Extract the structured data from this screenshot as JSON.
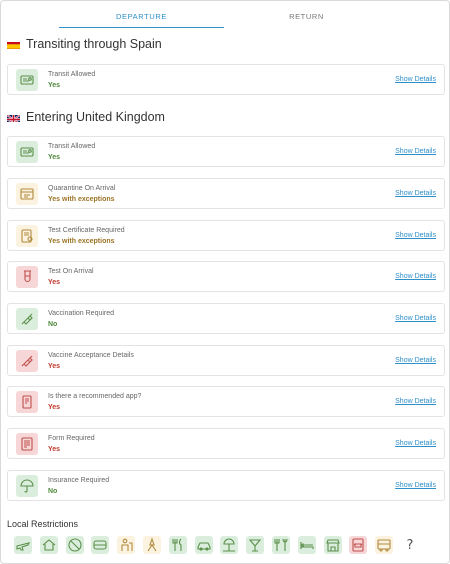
{
  "tabs": [
    {
      "label": "DEPARTURE",
      "active": true
    },
    {
      "label": "RETURN",
      "active": false
    }
  ],
  "transit": {
    "heading": "Transiting through Spain",
    "flag": "spain-flag",
    "items": [
      {
        "label": "Transit Allowed",
        "value": "Yes",
        "status": "green",
        "icon": "passport-icon",
        "details": "Show Details"
      }
    ]
  },
  "entry": {
    "heading": "Entering United Kingdom",
    "flag": "uk-flag",
    "items": [
      {
        "label": "Transit Allowed",
        "value": "Yes",
        "status": "green",
        "icon": "passport-icon",
        "details": "Show Details"
      },
      {
        "label": "Quarantine On Arrival",
        "value": "Yes with exceptions",
        "status": "yellow",
        "icon": "quarantine-icon",
        "details": "Show Details"
      },
      {
        "label": "Test Certificate Required",
        "value": "Yes with exceptions",
        "status": "yellow",
        "icon": "certificate-icon",
        "details": "Show Details"
      },
      {
        "label": "Test On Arrival",
        "value": "Yes",
        "status": "red",
        "icon": "test-tube-icon",
        "details": "Show Details"
      },
      {
        "label": "Vaccination Required",
        "value": "No",
        "status": "green",
        "icon": "syringe-icon",
        "details": "Show Details"
      },
      {
        "label": "Vaccine Acceptance Details",
        "value": "Yes",
        "status": "red",
        "icon": "syringe-icon",
        "details": "Show Details"
      },
      {
        "label": "Is there a recommended app?",
        "value": "Yes",
        "status": "red",
        "icon": "phone-app-icon",
        "details": "Show Details"
      },
      {
        "label": "Form Required",
        "value": "Yes",
        "status": "red",
        "icon": "form-icon",
        "details": "Show Details"
      },
      {
        "label": "Insurance Required",
        "value": "No",
        "status": "green",
        "icon": "umbrella-icon",
        "details": "Show Details"
      }
    ]
  },
  "local_restrictions": {
    "title": "Local Restrictions",
    "icons": [
      {
        "name": "domestic-flight-icon",
        "status": "green"
      },
      {
        "name": "home-icon",
        "status": "green"
      },
      {
        "name": "no-gathering-icon",
        "status": "green"
      },
      {
        "name": "public-transport-icon",
        "status": "green"
      },
      {
        "name": "workplace-icon",
        "status": "yellow"
      },
      {
        "name": "tourism-icon",
        "status": "yellow"
      },
      {
        "name": "restaurant-icon",
        "status": "green"
      },
      {
        "name": "car-icon",
        "status": "green"
      },
      {
        "name": "beach-icon",
        "status": "green"
      },
      {
        "name": "bar-icon",
        "status": "green"
      },
      {
        "name": "dining-icon",
        "status": "green"
      },
      {
        "name": "hotel-icon",
        "status": "green"
      },
      {
        "name": "shop-icon",
        "status": "green"
      },
      {
        "name": "mask-document-icon",
        "status": "red"
      },
      {
        "name": "school-bus-icon",
        "status": "yellow"
      },
      {
        "name": "unknown-icon",
        "status": "none"
      }
    ]
  },
  "colors": {
    "accent": "#2f8fc9",
    "green": "#4e8a3b",
    "yellow": "#9b7424",
    "red": "#c0392b"
  }
}
